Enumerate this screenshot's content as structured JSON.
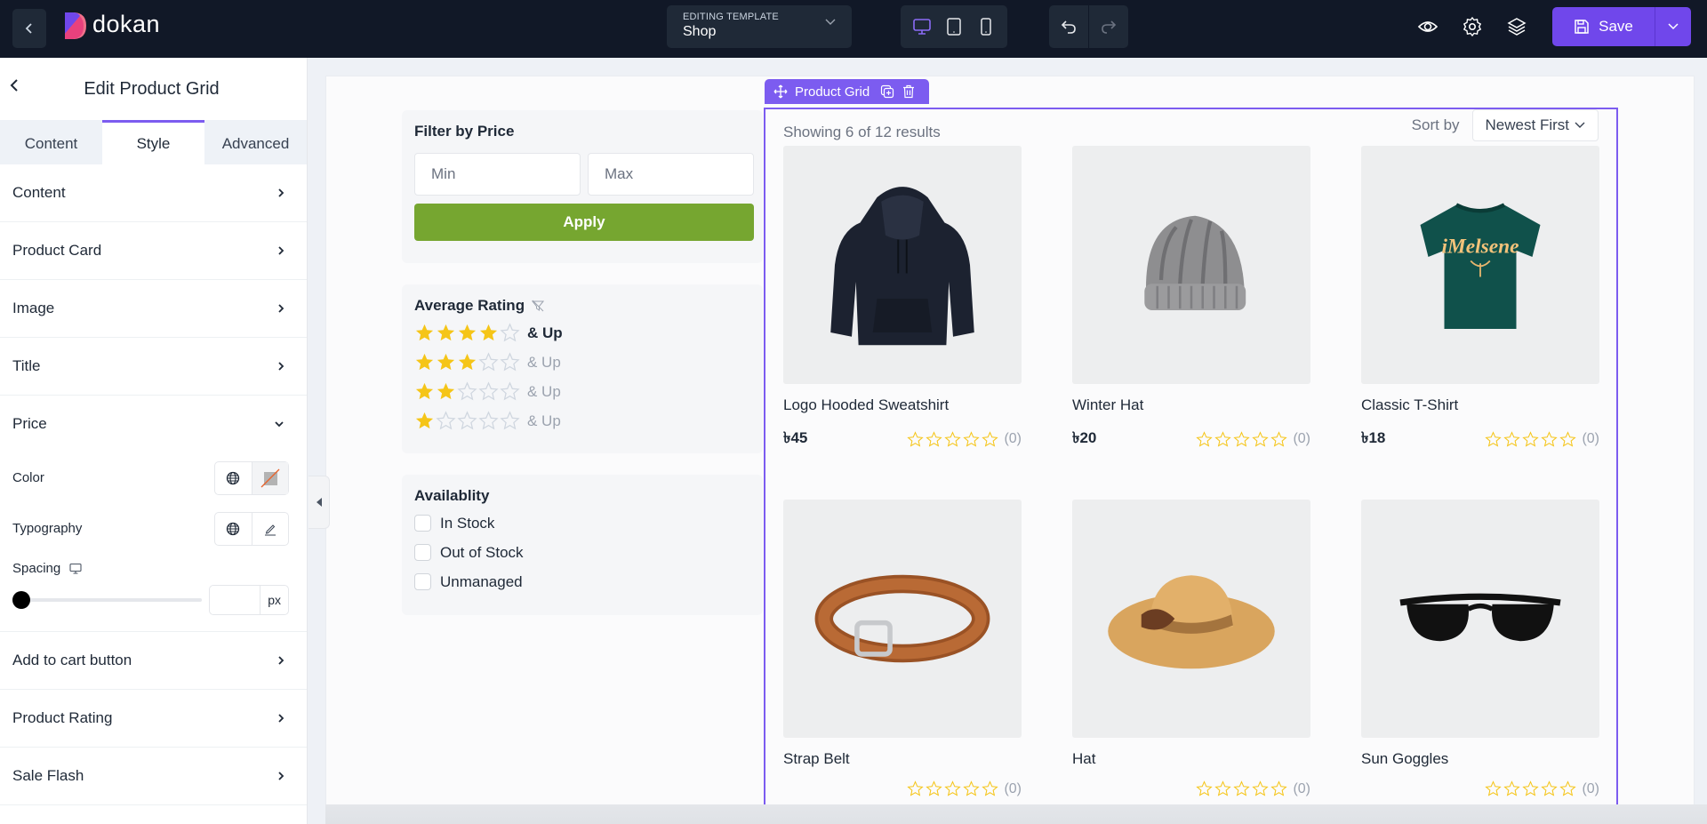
{
  "topbar": {
    "back_icon": "chevron-left-icon",
    "brand": "dokan",
    "template": {
      "label": "EDITING TEMPLATE",
      "value": "Shop"
    },
    "devices": [
      {
        "name": "desktop",
        "icon": "monitor-icon",
        "active": true
      },
      {
        "name": "tablet",
        "icon": "tablet-icon",
        "active": false
      },
      {
        "name": "mobile",
        "icon": "phone-icon",
        "active": false
      }
    ],
    "undo_icon": "undo-icon",
    "redo_icon": "redo-icon",
    "preview_icon": "eye-icon",
    "settings_icon": "gear-icon",
    "layers_icon": "layers-icon",
    "save_label": "Save",
    "accent": "#7047eb"
  },
  "sidebar": {
    "title": "Edit Product Grid",
    "tabs": [
      {
        "label": "Content",
        "active": false
      },
      {
        "label": "Style",
        "active": true
      },
      {
        "label": "Advanced",
        "active": false
      }
    ],
    "sections_top": [
      "Content",
      "Product Card",
      "Image",
      "Title"
    ],
    "price": {
      "label": "Price",
      "expanded": true,
      "color_label": "Color",
      "typography_label": "Typography",
      "spacing_label": "Spacing",
      "spacing_value": "",
      "spacing_unit": "px",
      "spacing_slider": 0
    },
    "sections_bottom": [
      "Add to cart button",
      "Product Rating",
      "Sale Flash"
    ]
  },
  "filters": {
    "price": {
      "title": "Filter by Price",
      "min_placeholder": "Min",
      "max_placeholder": "Max",
      "apply_label": "Apply",
      "apply_color": "#76a630"
    },
    "rating": {
      "title": "Average Rating",
      "rows": [
        {
          "stars": 4,
          "label": "& Up",
          "selected": true
        },
        {
          "stars": 3,
          "label": "& Up",
          "selected": false
        },
        {
          "stars": 2,
          "label": "& Up",
          "selected": false
        },
        {
          "stars": 1,
          "label": "& Up",
          "selected": false
        }
      ]
    },
    "availability": {
      "title": "Availablity",
      "options": [
        {
          "label": "In Stock",
          "checked": false
        },
        {
          "label": "Out of Stock",
          "checked": false
        },
        {
          "label": "Unmanaged",
          "checked": false
        }
      ]
    }
  },
  "grid": {
    "tag_label": "Product Grid",
    "result_count": "Showing 6 of 12 results",
    "sort_label": "Sort by",
    "sort_value": "Newest First",
    "products": [
      {
        "title": "Logo Hooded Sweatshirt",
        "price": "৳45",
        "rating_count": "(0)",
        "image": "hoodie"
      },
      {
        "title": "Winter Hat",
        "price": "৳20",
        "rating_count": "(0)",
        "image": "beanie"
      },
      {
        "title": "Classic T-Shirt",
        "price": "৳18",
        "rating_count": "(0)",
        "image": "tshirt"
      },
      {
        "title": "Strap Belt",
        "price": "",
        "rating_count": "(0)",
        "image": "belt"
      },
      {
        "title": "Hat",
        "price": "",
        "rating_count": "(0)",
        "image": "sunhat"
      },
      {
        "title": "Sun Goggles",
        "price": "",
        "rating_count": "(0)",
        "image": "sunglasses"
      }
    ]
  }
}
